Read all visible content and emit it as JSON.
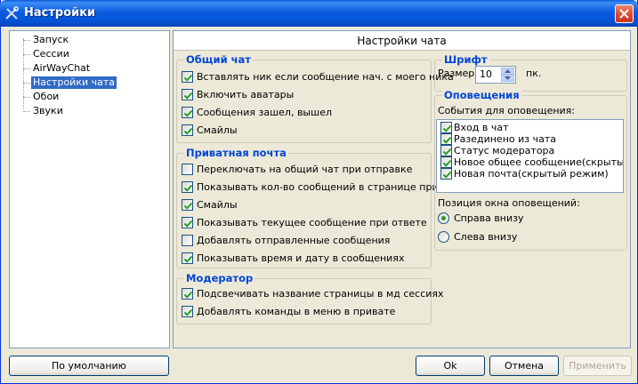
{
  "window": {
    "title": "Настройки",
    "icon": "tools-icon",
    "close_icon": "close-icon",
    "colors": {
      "titlebar": "#0553d6",
      "group_title": "#0046d5",
      "selection": "#316ac5",
      "face": "#ece9d8"
    }
  },
  "sidebar": {
    "items": [
      {
        "label": "Запуск",
        "selected": false
      },
      {
        "label": "Сессии",
        "selected": false
      },
      {
        "label": "AirWayChat",
        "selected": false
      },
      {
        "label": "Настройки чата",
        "selected": true
      },
      {
        "label": "Обои",
        "selected": false
      },
      {
        "label": "Звуки",
        "selected": false
      }
    ]
  },
  "main": {
    "header": "Настройки чата",
    "general_chat": {
      "title": "Общий чат",
      "options": [
        {
          "label": "Вставлять ник если сообщение нач. с моего ника",
          "checked": true
        },
        {
          "label": "Включить аватары",
          "checked": true
        },
        {
          "label": "Сообщения зашел, вышел",
          "checked": true
        },
        {
          "label": "Смайлы",
          "checked": true
        }
      ]
    },
    "private_mail": {
      "title": "Приватная почта",
      "options": [
        {
          "label": "Переключать на общий чат при отправке",
          "checked": false
        },
        {
          "label": "Показывать кол-во сообщений в странице прив.",
          "checked": true
        },
        {
          "label": "Смайлы",
          "checked": true
        },
        {
          "label": "Показывать текущее сообщение при ответе",
          "checked": true
        },
        {
          "label": "Добавлять отправленные сообщения",
          "checked": false
        },
        {
          "label": "Показывать время и дату в сообщениях",
          "checked": true
        }
      ]
    },
    "moderator": {
      "title": "Модератор",
      "options": [
        {
          "label": "Подсвечивать название страницы в мд сессиях",
          "checked": true
        },
        {
          "label": "Добавлять команды в меню в привате",
          "checked": true
        }
      ]
    },
    "font": {
      "title": "Шрифт",
      "size_label": "Размер",
      "size_value": "10",
      "unit": "пк."
    },
    "notifications": {
      "title": "Оповещения",
      "events_label": "События для оповещения:",
      "events": [
        {
          "label": "Вход в чат",
          "checked": true
        },
        {
          "label": "Разединено из чата",
          "checked": true
        },
        {
          "label": "Статус модератора",
          "checked": true
        },
        {
          "label": "Новое общее сообщение(скрытый ре",
          "checked": true
        },
        {
          "label": "Новая почта(скрытый режим)",
          "checked": true
        }
      ],
      "position_label": "Позиция окна оповещений:",
      "positions": [
        {
          "label": "Справа внизу",
          "checked": true
        },
        {
          "label": "Слева внизу",
          "checked": false
        }
      ]
    }
  },
  "buttons": {
    "defaults": "По умолчанию",
    "ok": "Ok",
    "cancel": "Отмена",
    "apply": "Применить"
  }
}
